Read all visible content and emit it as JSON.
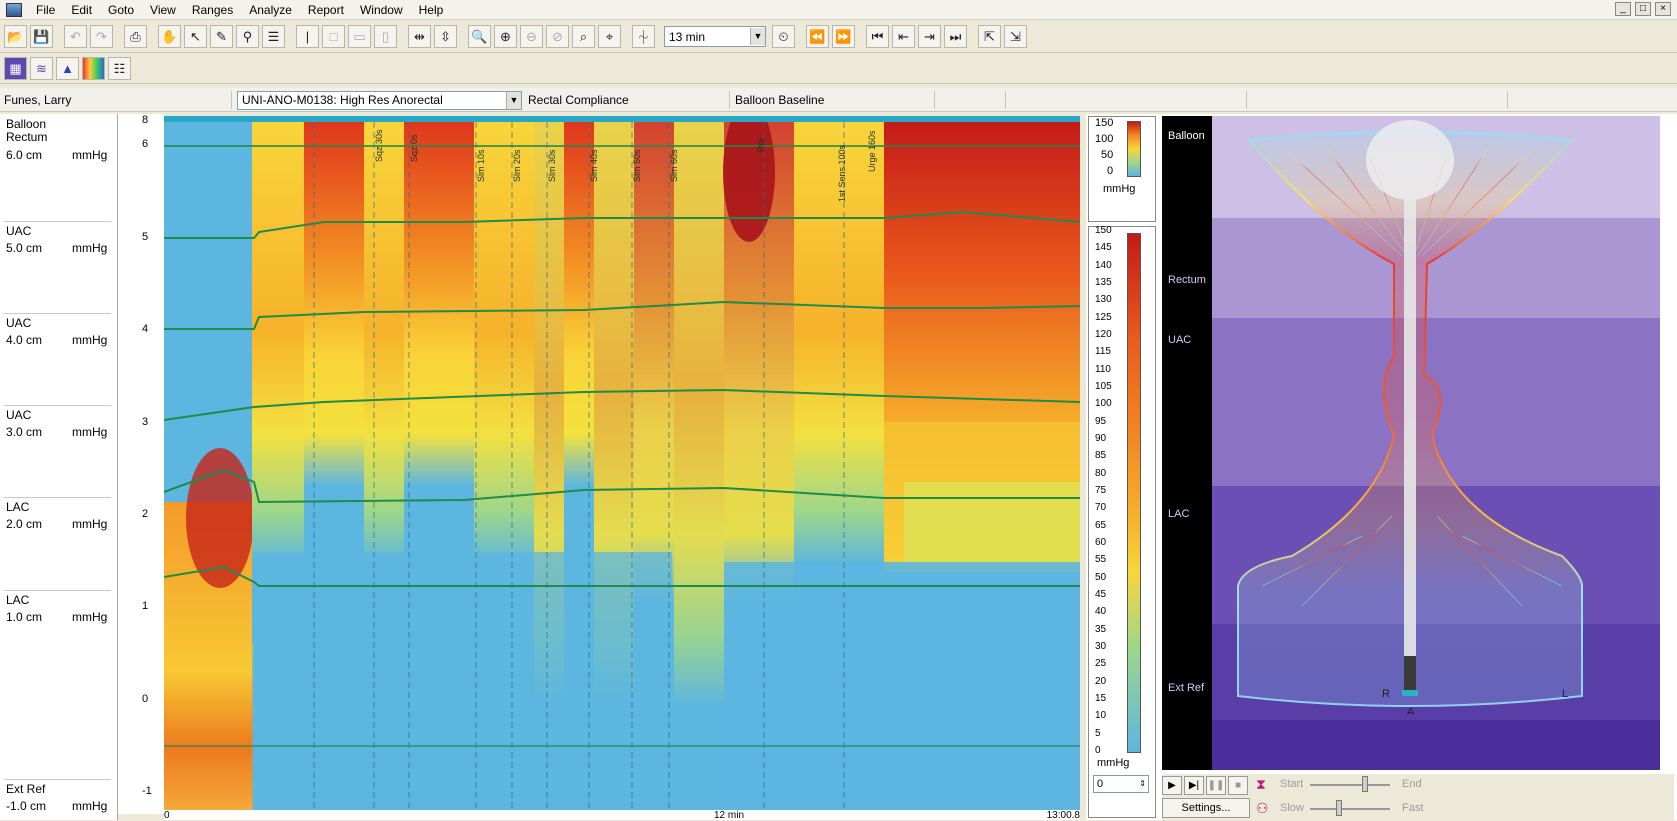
{
  "menu": [
    "File",
    "Edit",
    "Goto",
    "View",
    "Ranges",
    "Analyze",
    "Report",
    "Window",
    "Help"
  ],
  "window_controls": [
    "_",
    "□",
    "×"
  ],
  "toolbar": {
    "zoom_value": "13 min"
  },
  "infobar": {
    "patient": "Funes, Larry",
    "protocol": "UNI-ANO-M0138: High Res Anorectal",
    "study1": "Rectal Compliance",
    "study2": "Balloon Baseline"
  },
  "channels": [
    {
      "name": "Balloon",
      "sub": "Rectum",
      "pos": "6.0 cm",
      "unit": "mmHg"
    },
    {
      "name": "UAC",
      "sub": "",
      "pos": "5.0 cm",
      "unit": "mmHg"
    },
    {
      "name": "UAC",
      "sub": "",
      "pos": "4.0 cm",
      "unit": "mmHg"
    },
    {
      "name": "UAC",
      "sub": "",
      "pos": "3.0 cm",
      "unit": "mmHg"
    },
    {
      "name": "LAC",
      "sub": "",
      "pos": "2.0 cm",
      "unit": "mmHg"
    },
    {
      "name": "LAC",
      "sub": "",
      "pos": "1.0 cm",
      "unit": "mmHg"
    },
    {
      "name": "Ext Ref",
      "sub": "",
      "pos": "-1.0 cm",
      "unit": "mmHg"
    }
  ],
  "y_axis_ticks": [
    "6",
    "5",
    "4",
    "3",
    "2",
    "1",
    "0",
    "-1"
  ],
  "x_axis": {
    "start": "0",
    "mid": "12 min",
    "end": "13:00.8"
  },
  "event_markers": [
    "Sqz 30s",
    "Sqz 0s",
    "Slm 10s",
    "Slm 20s",
    "Slm 30s",
    "Slm 40s",
    "Slm 50s",
    "Slm 60s",
    "Rel",
    "1st Sens 100s",
    "Urge 160s"
  ],
  "colorbar_small": {
    "ticks": [
      "150",
      "100",
      "50",
      "0"
    ],
    "unit": "mmHg"
  },
  "colorbar_large": {
    "ticks": [
      "150",
      "145",
      "140",
      "135",
      "130",
      "125",
      "120",
      "115",
      "110",
      "105",
      "100",
      "95",
      "90",
      "85",
      "80",
      "75",
      "70",
      "65",
      "60",
      "55",
      "50",
      "45",
      "40",
      "35",
      "30",
      "25",
      "20",
      "15",
      "10",
      "5",
      "0"
    ],
    "unit": "mmHg",
    "input_value": "0"
  },
  "view3d_labels": {
    "balloon": "Balloon",
    "rectum": "Rectum",
    "uac": "UAC",
    "lac": "LAC",
    "extref": "Ext Ref",
    "r": "R",
    "a": "A",
    "l": "L"
  },
  "playback": {
    "settings": "Settings...",
    "start": "Start",
    "end": "End",
    "slow": "Slow",
    "fast": "Fast"
  }
}
